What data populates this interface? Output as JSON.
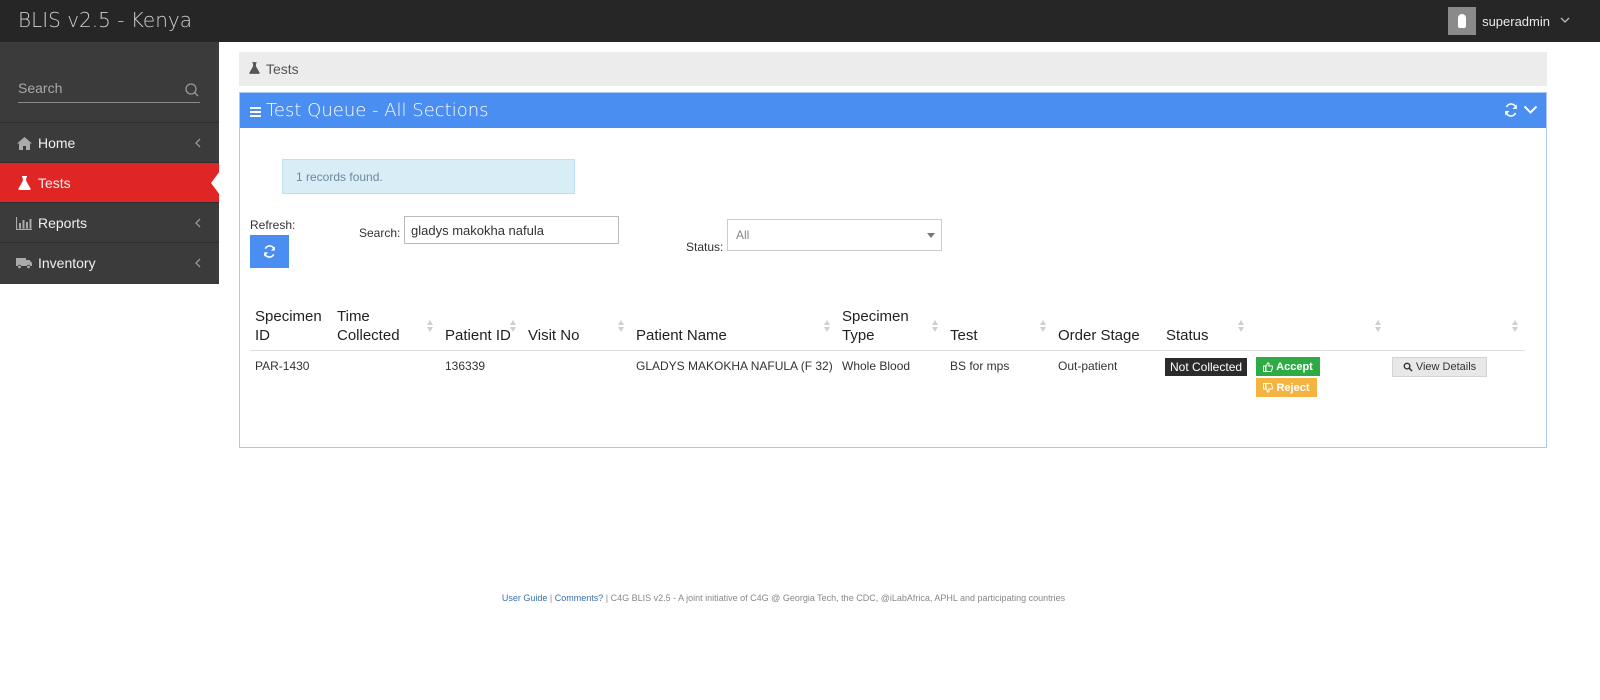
{
  "app": {
    "title": "BLIS v2.5 - Kenya"
  },
  "user": {
    "name": "superadmin"
  },
  "sidebar": {
    "search_placeholder": "Search",
    "items": [
      {
        "label": "Home",
        "icon": "home-icon",
        "active": false
      },
      {
        "label": "Tests",
        "icon": "flask-icon",
        "active": true
      },
      {
        "label": "Reports",
        "icon": "bar-chart-icon",
        "active": false
      },
      {
        "label": "Inventory",
        "icon": "truck-icon",
        "active": false
      }
    ]
  },
  "breadcrumb": {
    "label": "Tests"
  },
  "panel": {
    "title": "Test Queue - All Sections",
    "records_message": "1 records found.",
    "refresh_label": "Refresh:",
    "search_label": "Search:",
    "search_value": "gladys makokha nafula",
    "status_label": "Status:",
    "status_value": "All"
  },
  "table": {
    "columns": [
      {
        "line1": "Specimen",
        "line2": "ID"
      },
      {
        "line1": "Time",
        "line2": "Collected"
      },
      {
        "line1": "",
        "line2": "Patient ID"
      },
      {
        "line1": "",
        "line2": "Visit No"
      },
      {
        "line1": "",
        "line2": "Patient Name"
      },
      {
        "line1": "Specimen",
        "line2": "Type"
      },
      {
        "line1": "",
        "line2": "Test"
      },
      {
        "line1": "",
        "line2": "Order Stage"
      },
      {
        "line1": "",
        "line2": "Status"
      }
    ],
    "rows": [
      {
        "specimen_id": "PAR-1430",
        "time_collected": "",
        "patient_id": "136339",
        "visit_no": "",
        "patient_name": "GLADYS MAKOKHA NAFULA (F 32)",
        "specimen_type": "Whole Blood",
        "test": "BS for mps",
        "order_stage": "Out-patient",
        "status": "Not Collected",
        "accept_label": "Accept",
        "reject_label": "Reject",
        "view_label": "View Details"
      }
    ]
  },
  "footer": {
    "user_guide": "User Guide",
    "sep1": " | ",
    "comments": "Comments?",
    "text": " | C4G BLIS v2.5 - A joint initiative of C4G @ Georgia Tech, the CDC, @iLabAfrica, APHL and participating countries"
  },
  "colors": {
    "topbar": "#262626",
    "sidebar": "#3b3b3b",
    "active_item": "#e02525",
    "panel_header": "#4a8ef2",
    "accept": "#2eab45",
    "reject": "#f5b342"
  }
}
